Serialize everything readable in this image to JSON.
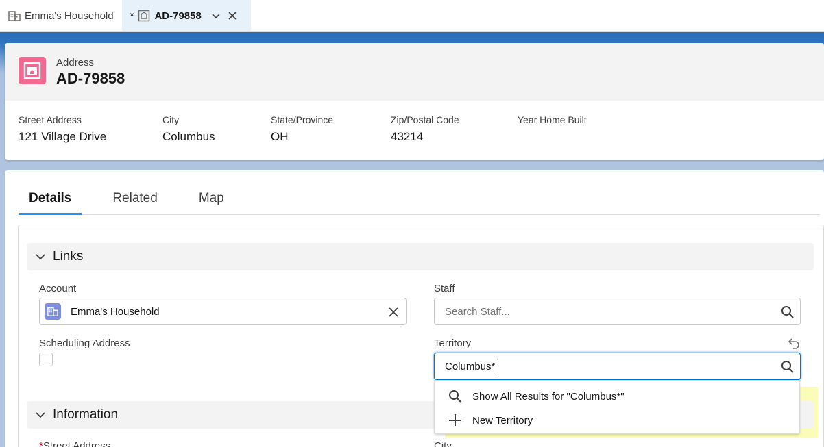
{
  "tabs": [
    {
      "label": "Emma's Household",
      "icon": "building-icon",
      "active": false
    },
    {
      "label": "AD-79858",
      "icon": "address-icon",
      "active": true,
      "unsaved_marker": "*"
    }
  ],
  "header": {
    "object_type": "Address",
    "record_name": "AD-79858",
    "icon": "address-icon",
    "icon_color": "#f26891",
    "fields": [
      {
        "label": "Street Address",
        "value": "121 Village Drive"
      },
      {
        "label": "City",
        "value": "Columbus"
      },
      {
        "label": "State/Province",
        "value": "OH"
      },
      {
        "label": "Zip/Postal Code",
        "value": "43214"
      },
      {
        "label": "Year Home Built",
        "value": ""
      }
    ]
  },
  "record_tabs": [
    {
      "label": "Details",
      "active": true
    },
    {
      "label": "Related",
      "active": false
    },
    {
      "label": "Map",
      "active": false
    }
  ],
  "sections": {
    "links": {
      "title": "Links",
      "account": {
        "label": "Account",
        "value": "Emma's Household"
      },
      "staff": {
        "label": "Staff",
        "placeholder": "Search Staff..."
      },
      "scheduling_address": {
        "label": "Scheduling Address",
        "checked": false
      },
      "territory": {
        "label": "Territory",
        "value": "Columbus*"
      }
    },
    "information": {
      "title": "Information",
      "street_label": "Street Address",
      "required_marker": "*",
      "city_label": "City"
    }
  },
  "territory_dropdown": {
    "show_all": "Show All Results for \"Columbus*\"",
    "new_item": "New Territory"
  },
  "colors": {
    "accent": "#1b96ff",
    "account_icon": "#7f8de1",
    "highlight": "#fafcb8",
    "focus": "#0176d3"
  }
}
